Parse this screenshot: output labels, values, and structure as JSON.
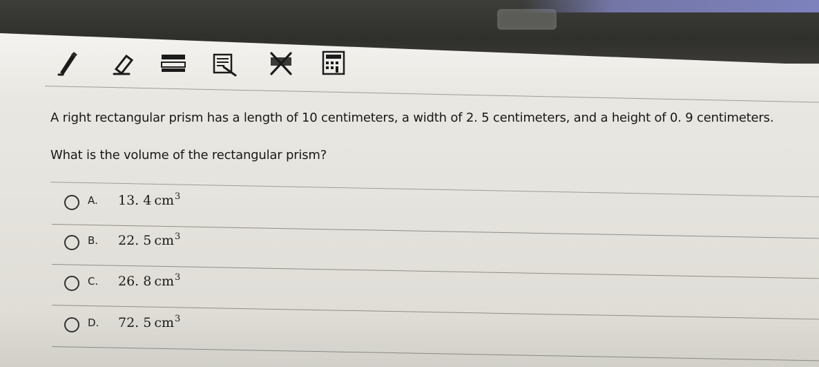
{
  "question": {
    "stem": "A right rectangular prism has a length of 10 centimeters, a width of 2. 5 centimeters, and a height of 0. 9 centimeters.",
    "prompt": "What is the volume of the rectangular prism?"
  },
  "choices": [
    {
      "letter": "A.",
      "value": "13. 4",
      "unit": "cm",
      "power": "3"
    },
    {
      "letter": "B.",
      "value": "22. 5",
      "unit": "cm",
      "power": "3"
    },
    {
      "letter": "C.",
      "value": "26. 8",
      "unit": "cm",
      "power": "3"
    },
    {
      "letter": "D.",
      "value": "72. 5",
      "unit": "cm",
      "power": "3"
    }
  ],
  "toolbar": {
    "icons": [
      "pencil-icon",
      "eraser-icon",
      "line-reader-icon",
      "notepad-icon",
      "eliminate-choice-icon",
      "calculator-icon"
    ]
  },
  "colors": {
    "accent": "#7d82be",
    "bezel": "#33332f",
    "text": "#171717"
  }
}
